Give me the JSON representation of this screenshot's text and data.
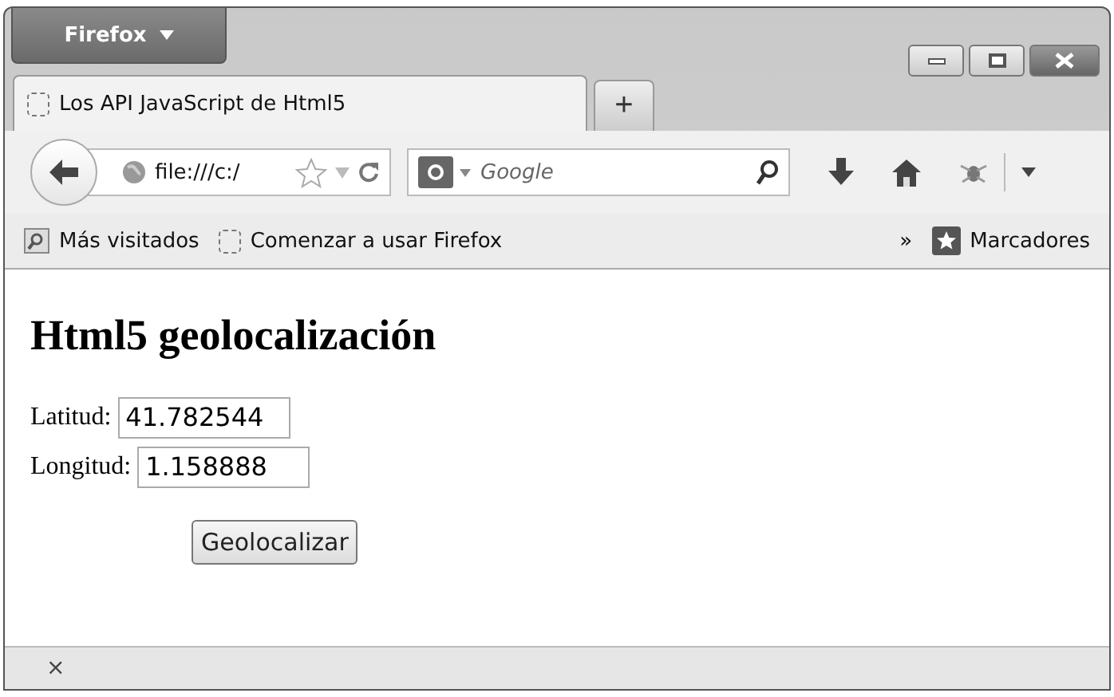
{
  "window": {
    "app_button": "Firefox"
  },
  "tabs": [
    {
      "title": "Los API JavaScript de Html5",
      "selected": true
    }
  ],
  "new_tab": "+",
  "navbar": {
    "url": "file:///c:/",
    "search_placeholder": "Google"
  },
  "bookmarks": {
    "items": [
      "Más visitados",
      "Comenzar a usar Firefox"
    ],
    "overflow": "»",
    "menu": "Marcadores"
  },
  "page": {
    "heading": "Html5 geolocalización",
    "fields": [
      {
        "label": "Latitud:",
        "value": "41.782544"
      },
      {
        "label": "Longitud:",
        "value": "1.158888"
      }
    ],
    "button": "Geolocalizar"
  },
  "status_bar": {
    "close": "×"
  }
}
